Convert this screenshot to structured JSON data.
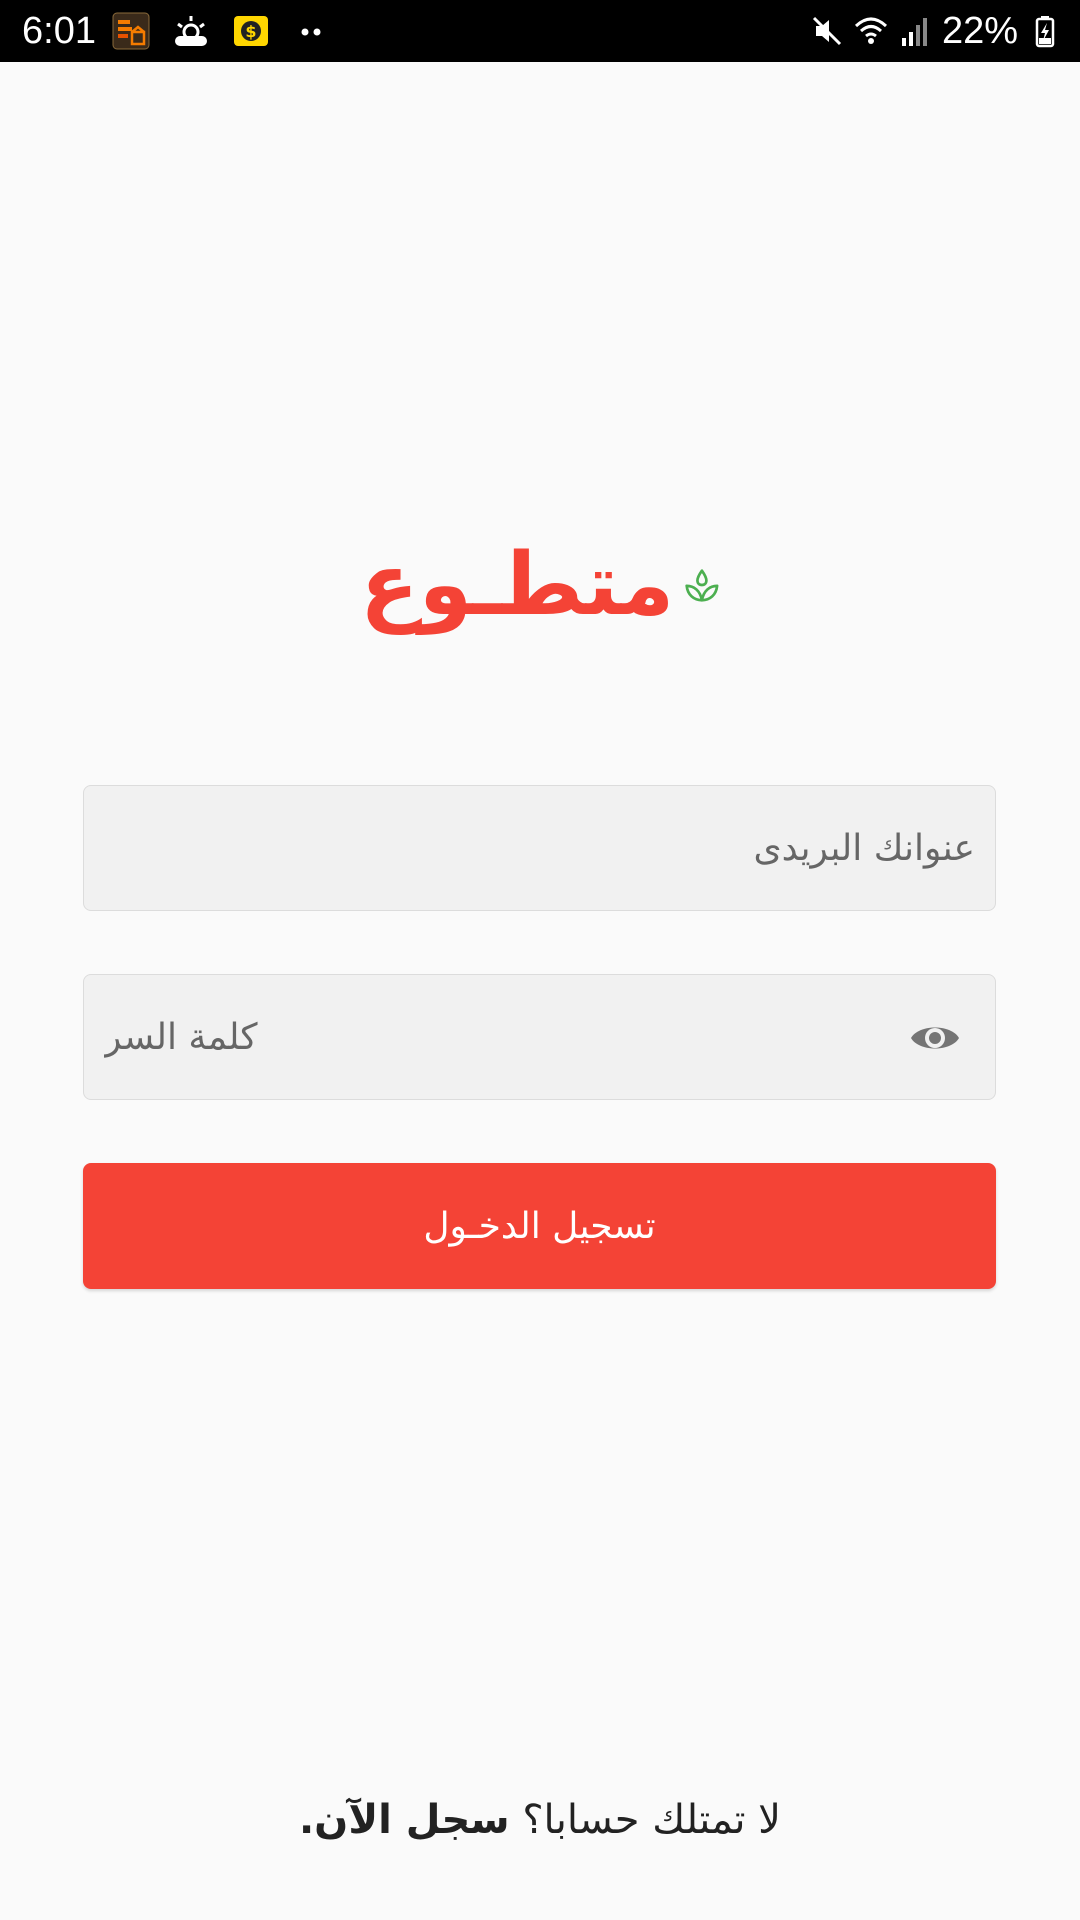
{
  "status_bar": {
    "time": "6:01",
    "battery_percent": "22%",
    "left_icons": [
      "app-notification-icon",
      "weather-icon",
      "money-app-icon",
      "more-notifications-icon"
    ],
    "right_icons": [
      "mute-icon",
      "wifi-icon",
      "signal-icon",
      "battery-charging-icon"
    ]
  },
  "logo": {
    "text": "متطـوع",
    "icon": "leaf-drop-icon"
  },
  "form": {
    "email_placeholder": "عنوانك البريدى",
    "password_placeholder": "كلمة السر",
    "password_toggle_icon": "eye-icon",
    "login_label": "تسجيل الدخـول"
  },
  "signup": {
    "prompt": "لا تمتلك حسابا؟",
    "link": "سجل الآن."
  },
  "colors": {
    "accent": "#f44336",
    "leaf": "#4caf50",
    "background": "#fafafa",
    "field_background": "#f1f1f1",
    "status_bar": "#000000"
  }
}
